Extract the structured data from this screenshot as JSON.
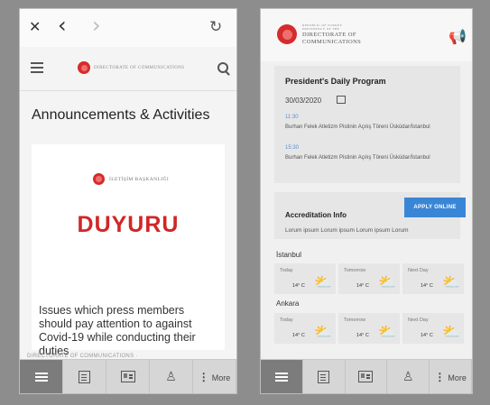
{
  "left": {
    "browser": {
      "close": "✕",
      "back": "‹",
      "forward": "›",
      "reload": "↻"
    },
    "header": {
      "logo_text": "DIRECTORATE OF COMMUNICATIONS",
      "icons": [
        "hamburger-icon",
        "search-icon"
      ]
    },
    "page_title": "Announcements & Activities",
    "card": {
      "logo_text": "İLETİŞİM BAŞKANLIĞI",
      "banner": "DUYURU",
      "headline": "Issues which press members should pay attention to against Covid-19 while conducting their duties",
      "meta": "DIRECTORATE OF COMMUNICATIONS ·"
    }
  },
  "right": {
    "header": {
      "logo_line1": "REPUBLIC OF TURKEY",
      "logo_line2": "PRESIDENCY OF THE",
      "logo_line3": "DIRECTORATE OF",
      "logo_line4": "COMMUNICATIONS"
    },
    "program": {
      "title": "President's Daily Program",
      "date": "30/03/2020",
      "events": [
        {
          "time": "11:30",
          "text": "Burhan Felek Atletizm Pistinin Açılış Töreni Üsküdar/İstanbul"
        },
        {
          "time": "15:30",
          "text": "Burhan Felek Atletizm Pistinin Açılış Töreni Üsküdar/İstanbul"
        }
      ]
    },
    "accreditation": {
      "title": "Accreditation Info",
      "button": "APPLY ONLINE",
      "text": "Lorum ipsum Lorum ipsum Lorum ipsum Lorum"
    },
    "weather": [
      {
        "city": "İstanbul",
        "days": [
          {
            "label": "Today",
            "temp": "14° C"
          },
          {
            "label": "Tomorrow",
            "temp": "14° C"
          },
          {
            "label": "Next Day",
            "temp": "14° C"
          }
        ]
      },
      {
        "city": "Ankara",
        "days": [
          {
            "label": "Today",
            "temp": "14° C"
          },
          {
            "label": "Tomorrow",
            "temp": "14° C"
          },
          {
            "label": "Next Day",
            "temp": "14° C"
          }
        ]
      }
    ]
  },
  "bottom_nav": {
    "items": [
      "menu-icon",
      "news-icon",
      "id-card-icon",
      "people-icon"
    ],
    "more_label": "More"
  },
  "colors": {
    "brand_red": "#d12626",
    "accent_blue": "#3a86d6",
    "active_tab": "#7c7c7c"
  }
}
